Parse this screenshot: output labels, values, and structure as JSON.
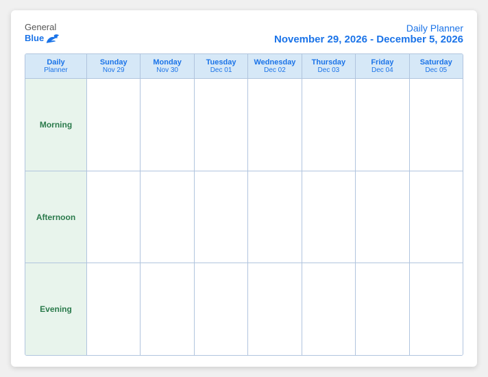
{
  "header": {
    "logo_general": "General",
    "logo_blue": "Blue",
    "title": "Daily Planner",
    "date_range": "November 29, 2026 - December 5, 2026"
  },
  "columns": [
    {
      "id": "label",
      "day_name": "Daily",
      "day_sub": "Planner"
    },
    {
      "id": "sun",
      "day_name": "Sunday",
      "day_sub": "Nov 29"
    },
    {
      "id": "mon",
      "day_name": "Monday",
      "day_sub": "Nov 30"
    },
    {
      "id": "tue",
      "day_name": "Tuesday",
      "day_sub": "Dec 01"
    },
    {
      "id": "wed",
      "day_name": "Wednesday",
      "day_sub": "Dec 02"
    },
    {
      "id": "thu",
      "day_name": "Thursday",
      "day_sub": "Dec 03"
    },
    {
      "id": "fri",
      "day_name": "Friday",
      "day_sub": "Dec 04"
    },
    {
      "id": "sat",
      "day_name": "Saturday",
      "day_sub": "Dec 05"
    }
  ],
  "rows": [
    {
      "id": "morning",
      "label": "Morning"
    },
    {
      "id": "afternoon",
      "label": "Afternoon"
    },
    {
      "id": "evening",
      "label": "Evening"
    }
  ]
}
